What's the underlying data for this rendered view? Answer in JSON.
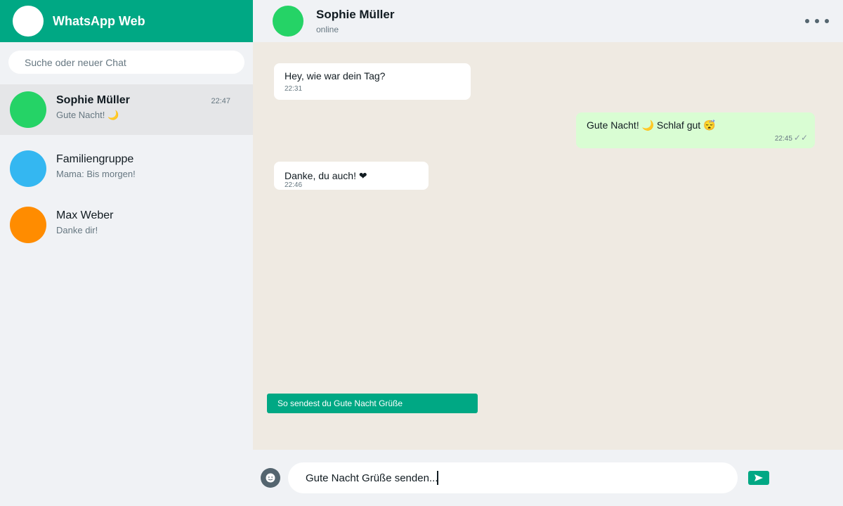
{
  "app": {
    "title": "WhatsApp Web",
    "accent": "#00a884"
  },
  "search": {
    "placeholder": "Suche oder neuer Chat",
    "icon": "search-icon"
  },
  "chats": [
    {
      "name": "Sophie Müller",
      "preview": "Gute Nacht! 🌙",
      "time": "22:47",
      "avatar_color": "#25d366",
      "active": true
    },
    {
      "name": "Familiengruppe",
      "preview": "Mama: Bis morgen!",
      "time": "",
      "avatar_color": "#34b7f1",
      "active": false
    },
    {
      "name": "Max Weber",
      "preview": "Danke dir!",
      "time": "",
      "avatar_color": "#ff8c00",
      "active": false
    }
  ],
  "conversation": {
    "contact_name": "Sophie Müller",
    "status": "online",
    "avatar_color": "#25d366",
    "menu_icon": "more-vertical-icon",
    "messages": [
      {
        "direction": "in",
        "text": "Hey, wie war dein Tag?",
        "time": "22:31"
      },
      {
        "direction": "out",
        "text": "Gute Nacht! 🌙 Schlaf gut 😴",
        "time": "22:45",
        "ticks": "✓✓"
      },
      {
        "direction": "in",
        "text": "Danke, du auch! ❤",
        "time": "22:46"
      }
    ]
  },
  "banner": {
    "text": "So sendest du Gute Nacht Grüße"
  },
  "composer": {
    "value": "Gute Nacht Grüße senden...",
    "emoji_icon": "emoji-icon",
    "send_icon": "send-icon"
  }
}
